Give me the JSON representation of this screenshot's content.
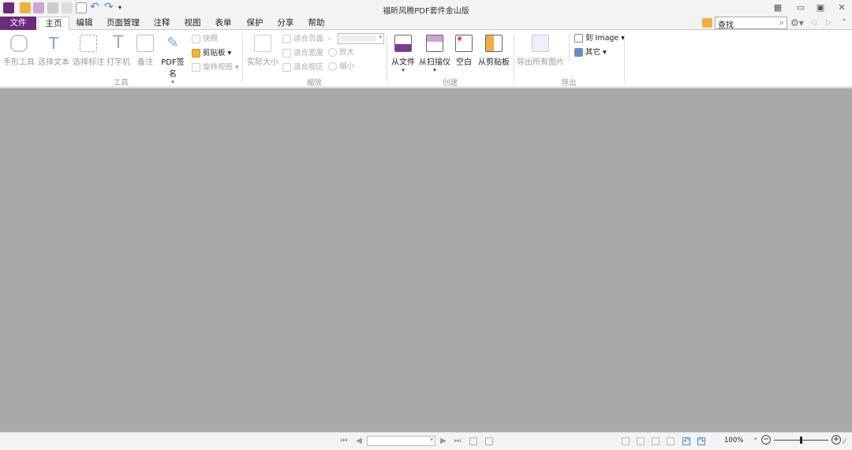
{
  "app": {
    "title": "福昕风腾PDF套件金山版"
  },
  "tabs": [
    {
      "label": "文件"
    },
    {
      "label": "主页"
    },
    {
      "label": "编辑"
    },
    {
      "label": "页面管理"
    },
    {
      "label": "注释"
    },
    {
      "label": "视图"
    },
    {
      "label": "表单"
    },
    {
      "label": "保护"
    },
    {
      "label": "分享"
    },
    {
      "label": "帮助"
    }
  ],
  "search": {
    "value": "查找"
  },
  "ribbon": {
    "tools": {
      "label": "工具",
      "hand": "手形工具",
      "select_text": "选择文本",
      "select_annot": "选择标注",
      "typewriter": "打字机",
      "note": "备注",
      "pdf_sign": "PDF签名",
      "snapshot": "快照",
      "clipboard": "剪贴板",
      "rotate": "旋转视图"
    },
    "zoom": {
      "label": "缩放",
      "actual": "实际大小",
      "fit_page": "适合页面",
      "fit_width": "适合宽度",
      "fit_visible": "适合视区",
      "zoom_in": "放大",
      "zoom_out": "缩小",
      "zoom_value": ""
    },
    "create": {
      "label": "创建",
      "from_file": "从文件",
      "from_scanner": "从扫描仪",
      "blank": "空白",
      "from_clipboard": "从剪贴板"
    },
    "export": {
      "label": "导出",
      "export_images": "导出所有图片",
      "to_image": "到 Image",
      "other": "其它"
    }
  },
  "status": {
    "page_value": "",
    "zoom": "100%",
    "zoom_slider": 0.5
  }
}
